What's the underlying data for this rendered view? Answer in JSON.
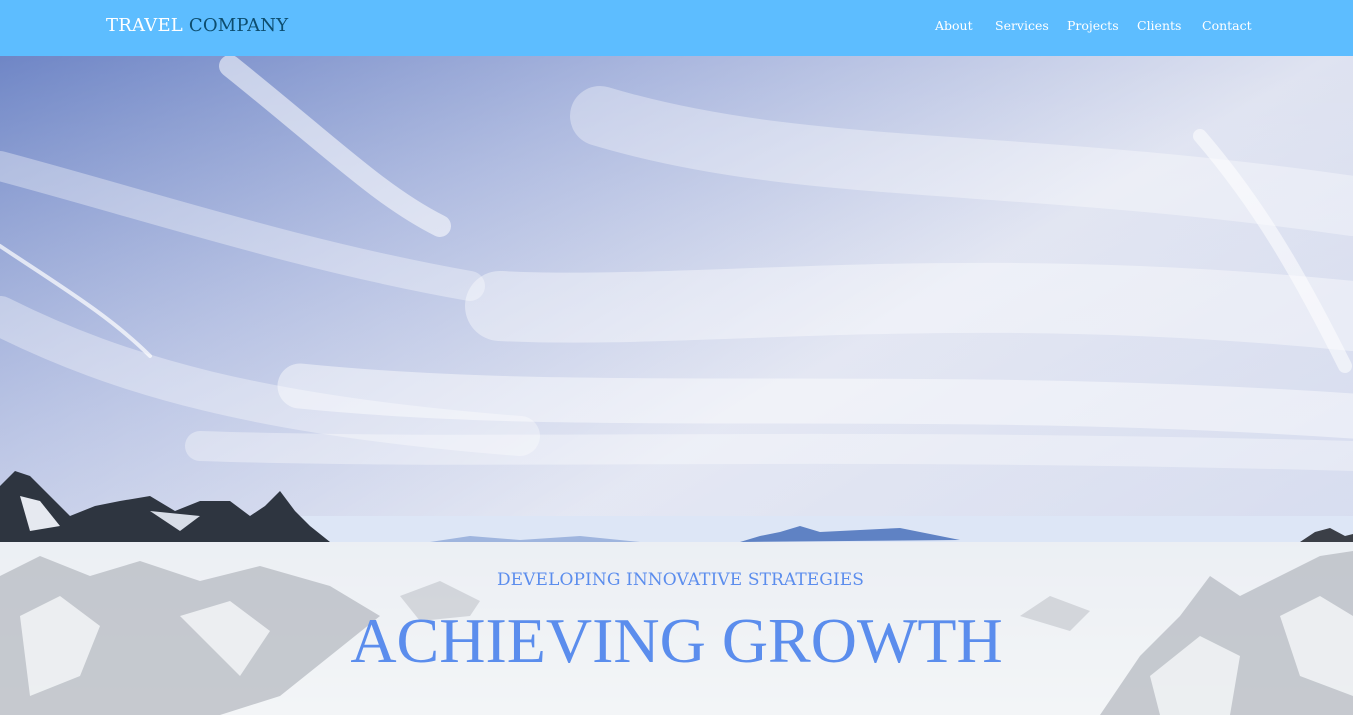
{
  "brand": {
    "word1": "TRAVEL",
    "word2": "COMPANY"
  },
  "nav": {
    "items": [
      "About",
      "Services",
      "Projects",
      "Clients",
      "Contact"
    ]
  },
  "hero": {
    "subtitle": "DEVELOPING INNOVATIVE STRATEGIES",
    "title": "ACHIEVING GROWTH",
    "image": "snowy-mountains-and-sky"
  },
  "colors": {
    "navbar": "#5dbdff",
    "brand_secondary": "#0d4d6e",
    "hero_text": "#5b8ded"
  }
}
